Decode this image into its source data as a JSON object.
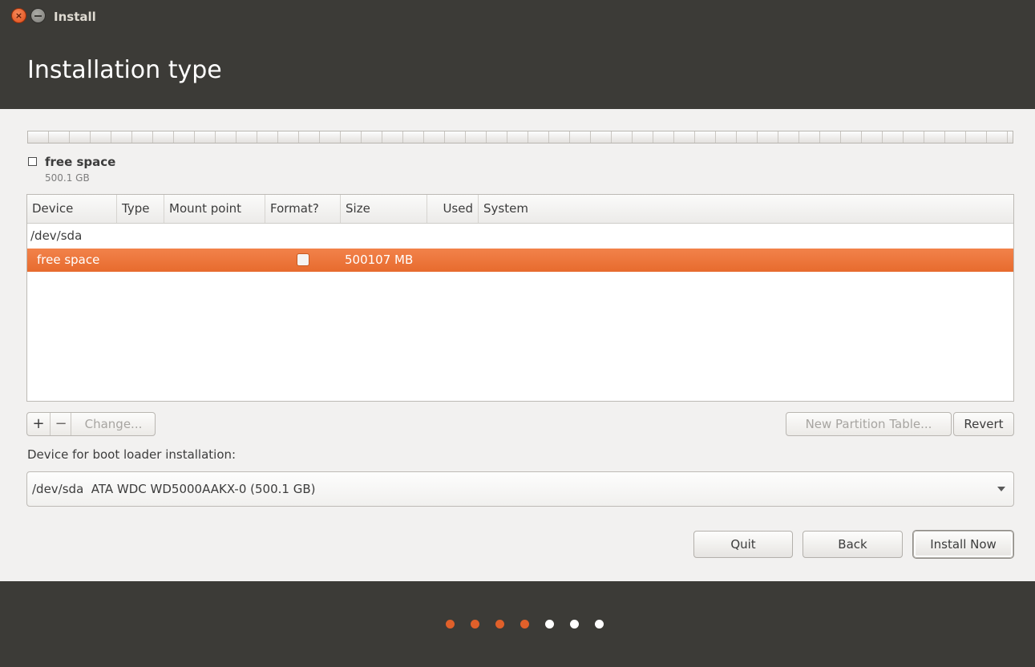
{
  "window": {
    "title": "Install",
    "close_glyph": "×"
  },
  "page": {
    "title": "Installation type"
  },
  "disk_legend": {
    "label": "free space",
    "size": "500.1 GB"
  },
  "table": {
    "columns": [
      "Device",
      "Type",
      "Mount point",
      "Format?",
      "Size",
      "Used",
      "System"
    ],
    "rows": [
      {
        "device": "/dev/sda"
      },
      {
        "device": "free space",
        "format_checked": false,
        "size": "500107 MB",
        "selected": true
      }
    ]
  },
  "partition_buttons": {
    "add": "+",
    "remove": "−",
    "change": "Change...",
    "new_table": "New Partition Table...",
    "revert": "Revert"
  },
  "bootloader": {
    "label": "Device for boot loader installation:",
    "selected": "/dev/sda  ATA WDC WD5000AAKX-0 (500.1 GB)"
  },
  "actions": {
    "quit": "Quit",
    "back": "Back",
    "install": "Install Now"
  },
  "progress": {
    "total_steps": 7,
    "completed_steps": 4,
    "active_color": "#e0602a",
    "inactive_color": "#ffffff"
  },
  "colors": {
    "selection": "#f07a40",
    "header_bg": "#3c3b37"
  }
}
